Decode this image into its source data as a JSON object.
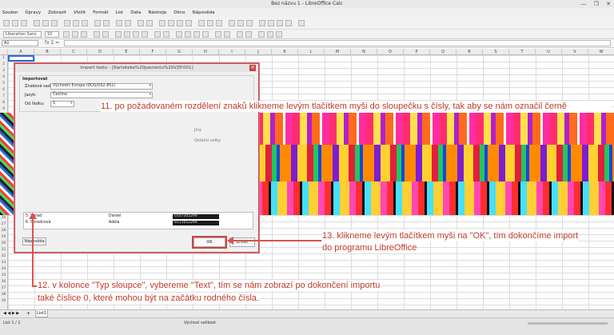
{
  "window": {
    "title": "Bez názvu 1 - LibreOffice Calc",
    "controls": [
      "—",
      "❐",
      "✕"
    ]
  },
  "menubar": [
    "Soubor",
    "Úpravy",
    "Zobrazit",
    "Vložit",
    "Formát",
    "List",
    "Data",
    "Nástroje",
    "Okno",
    "Nápověda"
  ],
  "toolbar": {
    "font_name": "Liberation Sans",
    "font_size": "10"
  },
  "formula_bar": {
    "name_box": "A1",
    "fx_label": "fx Σ ="
  },
  "columns": [
    "A",
    "B",
    "C",
    "D",
    "E",
    "F",
    "G",
    "H",
    "I",
    "J",
    "K",
    "L",
    "M",
    "N",
    "O",
    "P",
    "Q",
    "R",
    "S",
    "T",
    "U",
    "V",
    "W"
  ],
  "rows": [
    "1",
    "2",
    "3",
    "4",
    "5",
    "6",
    "7",
    "8",
    "9",
    "10",
    "11",
    "12",
    "13",
    "14",
    "15",
    "16",
    "17",
    "18",
    "19",
    "20",
    "21",
    "22",
    "23",
    "24",
    "25",
    "26",
    "27",
    "28",
    "29",
    "30",
    "31",
    "32",
    "33",
    "34",
    "35",
    "36",
    "37",
    "38",
    "39"
  ],
  "sheet_tab": "List1",
  "status_bar": {
    "left": "List 1 / 1",
    "mid": "Výchozí velikost"
  },
  "dialog": {
    "title": "Import textu - [Kartoteka%20pacientu%20VZP.001]",
    "group_label": "Importovat",
    "charset_label": "Znaková sada:",
    "charset_value": "Východní Evropa (DOS/OS2-852)",
    "language_label": "Jazyk:",
    "language_value": "Čeština",
    "from_row_label": "Od řádku:",
    "from_row_value": "1",
    "other_label": "Jiný",
    "other_options_label": "Ostatní volby",
    "help_button": "Nápověda",
    "ok_button": "OK",
    "cancel_button": "Zrušit",
    "preview_rows": [
      {
        "num": "5",
        "surname": "Sbrad",
        "name": "Daniel",
        "id": "0107305299"
      },
      {
        "num": "6",
        "surname": "Sbradcová",
        "name": "Adéla",
        "id": "9111012299"
      }
    ]
  },
  "annotations": {
    "step11": "11. po požadovaném rozdělení znaků klikneme levým tlačítkem myši do sloupečku s čísly, tak aby se nám označil černě",
    "step13_line1": "13. klikneme levým tlačítkem myši na \"OK\", tím dokončíme import",
    "step13_line2": "do programu LibreOffice",
    "step12_line1": "12. v kolonce \"Typ sloupce\", vybereme \"Text\", tím se nám zobrazí po dokončení importu",
    "step12_line2": "také číslice 0, které mohou být na začátku rodného čísla."
  },
  "colors": {
    "annotation_red": "#c0392b",
    "highlight_red": "#c94646"
  }
}
